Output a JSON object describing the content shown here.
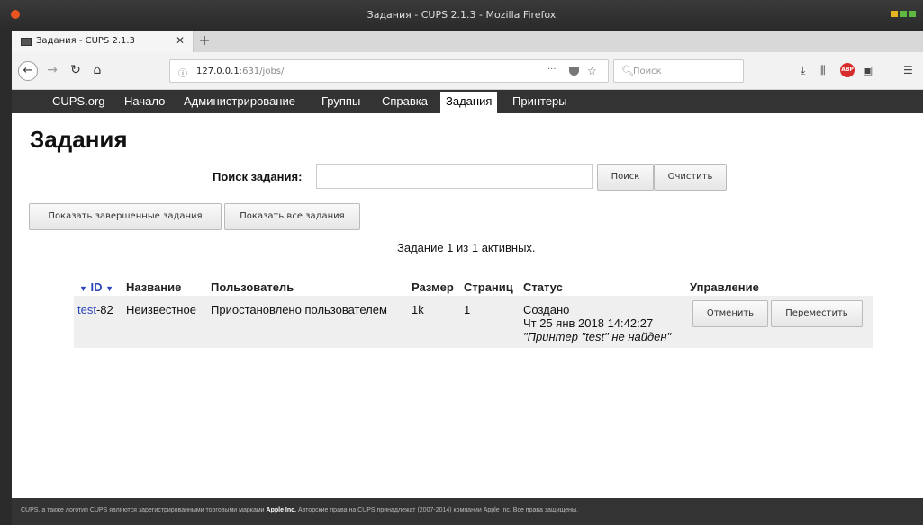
{
  "window": {
    "title": "Задания - CUPS 2.1.3 - Mozilla Firefox"
  },
  "browser": {
    "tab_title": "Задания - CUPS 2.1.3",
    "url_host": "127.0.0.1",
    "url_rest": ":631/jobs/",
    "search_placeholder": "Поиск"
  },
  "cups_menu": {
    "items": [
      "CUPS.org",
      "Начало",
      "Администрирование",
      "Группы",
      "Справка",
      "Задания",
      "Принтеры"
    ],
    "active": "Задания"
  },
  "page": {
    "title": "Задания",
    "search_label": "Поиск задания",
    "search_button": "Поиск",
    "clear_button": "Очистить",
    "show_completed_button": "Показать завершенные задания",
    "show_all_button": "Показать все задания",
    "summary": "Задание 1 из 1 активных."
  },
  "jobs_table": {
    "headers": {
      "id": "ID",
      "name": "Название",
      "user": "Пользователь",
      "size": "Размер",
      "pages": "Страниц",
      "status": "Статус",
      "control": "Управление"
    },
    "rows": [
      {
        "id_link": "test",
        "id_num": "-82",
        "name": "Неизвестное",
        "user": "Приостановлено пользователем",
        "size": "1k",
        "pages": "1",
        "status": "Создано",
        "status_time": "Чт 25 янв 2018 14:42:27",
        "status_note": "\"Принтер \"test\" не найден\"",
        "cancel_button": "Отменить",
        "move_button": "Переместить"
      }
    ]
  },
  "footer": {
    "text_before": "CUPS, а также логотип CUPS являются зарегистрированными торговыми марками",
    "apple": "Apple Inc.",
    "text_mid": "Авторские права на CUPS принадлежат (2007-2014) компании Apple Inc. Все права защищены."
  }
}
